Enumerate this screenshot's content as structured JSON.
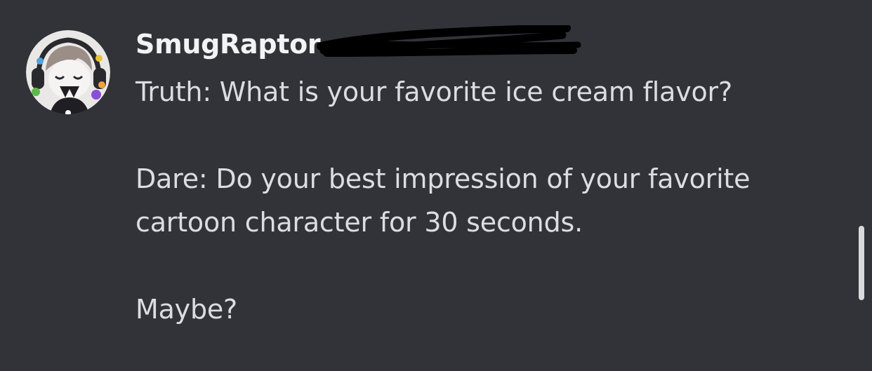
{
  "message": {
    "author": "SmugRaptor",
    "timestamp": "",
    "lines": [
      "Truth: What is your favorite ice cream flavor?",
      "",
      "Dare: Do your best impression of your favorite cartoon character for 30 seconds.",
      "",
      "Maybe?"
    ]
  },
  "colors": {
    "background": "#313338",
    "username": "#f2f3f5",
    "text": "#dbdee1",
    "redaction": "#000000",
    "scrollbar": "#d9dadc"
  },
  "icons": {
    "avatar": "user-avatar-anime-character"
  }
}
